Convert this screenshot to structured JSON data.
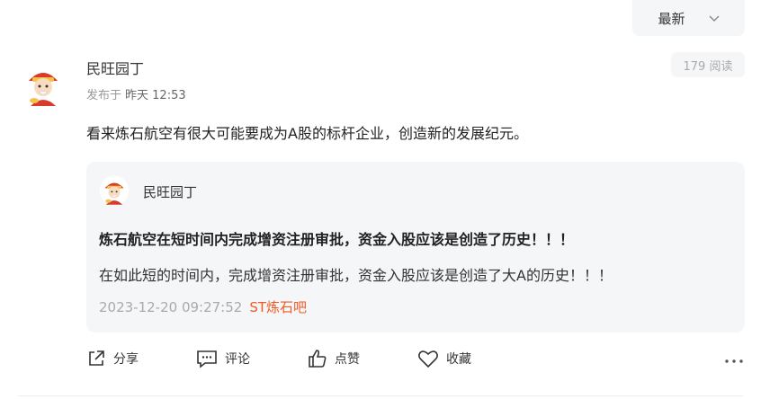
{
  "sort": {
    "label": "最新"
  },
  "post": {
    "author": "民旺园丁",
    "posted_prefix": "发布于",
    "posted_time": "昨天 12:53",
    "reads": "179 阅读",
    "content": "看来炼石航空有很大可能要成为A股的标杆企业，创造新的发展纪元。"
  },
  "quote": {
    "author": "民旺园丁",
    "title": "炼石航空在短时间内完成增资注册审批，资金入股应该是创造了历史！！！",
    "body": "在如此短的时间内，完成增资注册审批，资金入股应该是创造了大A的历史！！！",
    "datetime": "2023-12-20 09:27:52",
    "forum": "ST炼石吧"
  },
  "actions": {
    "share": "分享",
    "comment": "评论",
    "like": "点赞",
    "favorite": "收藏"
  },
  "colors": {
    "accent": "#f15a24",
    "panel": "#f5f6f8"
  }
}
